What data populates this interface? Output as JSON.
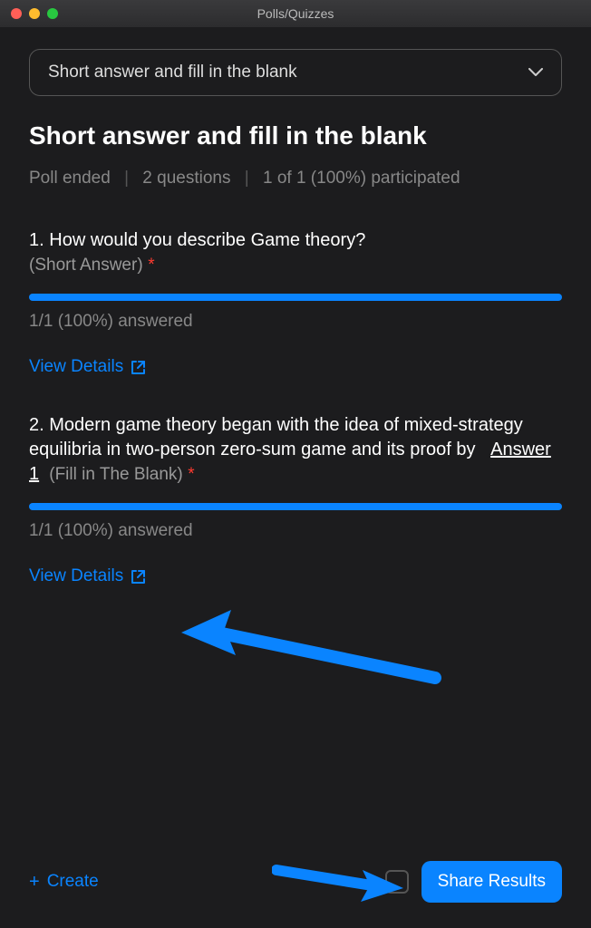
{
  "window": {
    "title": "Polls/Quizzes"
  },
  "dropdown": {
    "selected": "Short answer and fill in the blank"
  },
  "page": {
    "title": "Short answer and fill in the blank"
  },
  "meta": {
    "status": "Poll ended",
    "questions": "2 questions",
    "participation": "1 of 1 (100%) participated"
  },
  "questions": [
    {
      "number": "1.",
      "text": "How would you describe Game theory?",
      "type_label": "(Short Answer)",
      "required": "*",
      "answered": "1/1 (100%) answered",
      "view_details": "View Details"
    },
    {
      "number": "2.",
      "text_prefix": "Modern game theory began with the idea of mixed-strategy equilibria in two-person zero-sum game and its proof by",
      "answer_slot": "Answer 1",
      "type_label": "(Fill in The Blank)",
      "required": "*",
      "answered": "1/1 (100%) answered",
      "view_details": "View Details"
    }
  ],
  "footer": {
    "create": "Create",
    "share": "Share Results"
  },
  "colors": {
    "accent": "#0a84ff",
    "bg": "#1c1c1e",
    "muted": "#888"
  }
}
